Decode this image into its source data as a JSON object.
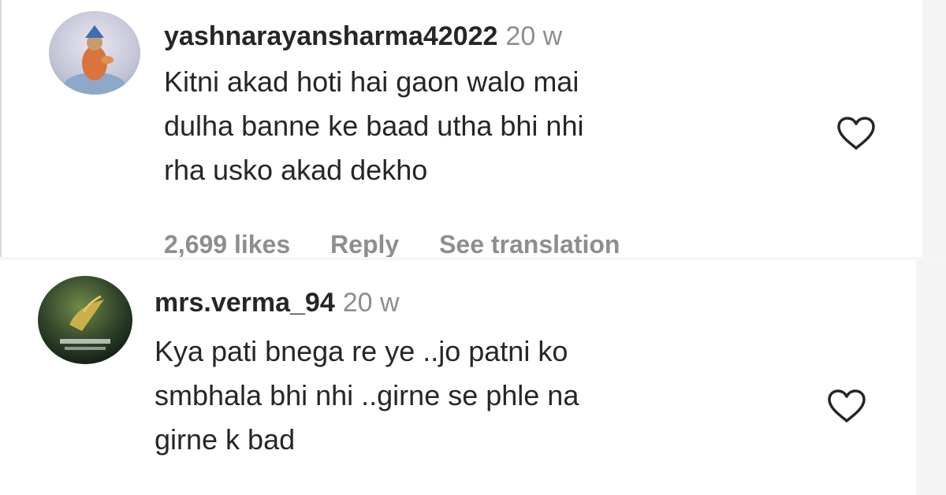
{
  "comments": [
    {
      "username": "yashnarayansharma42022",
      "time": "20 w",
      "lines": [
        "Kitni akad hoti hai gaon walo mai",
        "dulha banne ke baad utha bhi nhi",
        "rha usko akad dekho"
      ],
      "likes": "2,699 likes",
      "reply_label": "Reply",
      "translate_label": "See translation",
      "avatar_icon": "profile-photo",
      "like_icon": "heart-outline-icon"
    },
    {
      "username": "mrs.verma_94",
      "time": "20 w",
      "lines": [
        "Kya pati bnega re ye ..jo patni ko",
        "smbhala bhi nhi ..girne se phle na",
        "girne k bad"
      ],
      "avatar_icon": "profile-photo",
      "like_icon": "heart-outline-icon"
    }
  ],
  "colors": {
    "text_primary": "#262626",
    "text_secondary": "#8e8e8e",
    "background": "#ffffff"
  }
}
